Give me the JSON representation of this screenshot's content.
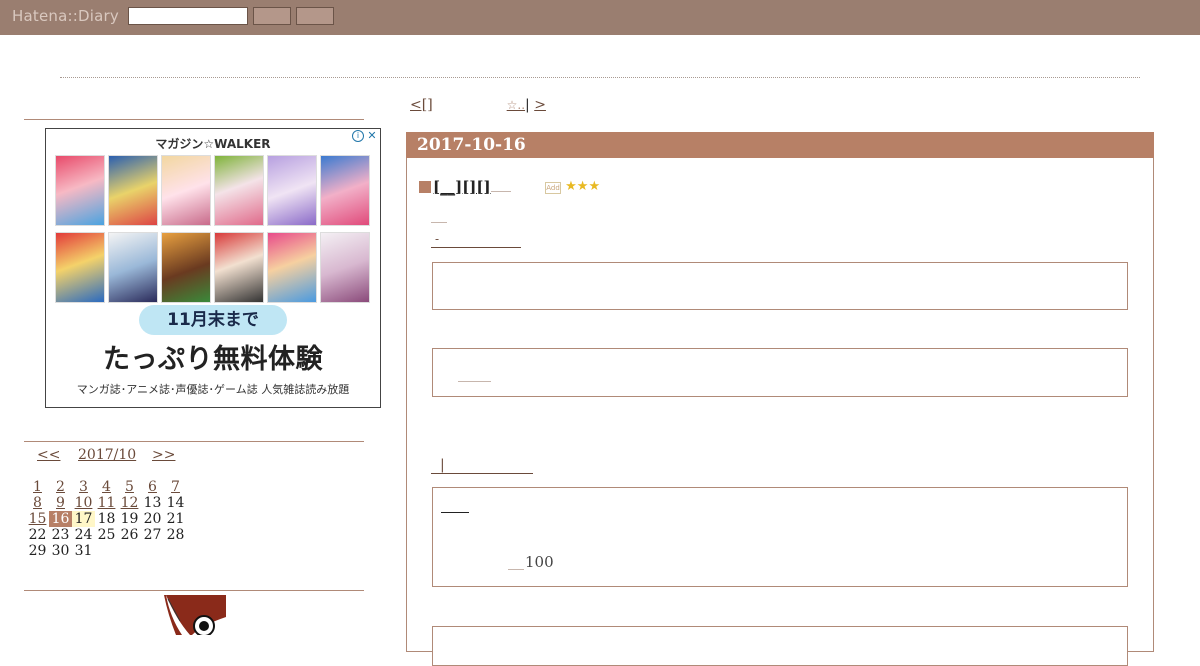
{
  "header": {
    "logo": "Hatena::Diary",
    "search_placeholder": ""
  },
  "sidebar": {
    "ad": {
      "title": "マガジン☆WALKER",
      "close_glyph": "✕",
      "info_glyph": "i",
      "deadline": "11月末まで",
      "headline": "たっぷり無料体験",
      "subline": "マンガ誌･アニメ誌･声優誌･ゲーム誌 人気雑誌読み放題"
    },
    "calendar": {
      "prev": "<<",
      "month": "2017/10",
      "next": ">>",
      "weeks": [
        [
          "1",
          "2",
          "3",
          "4",
          "5",
          "6",
          "7"
        ],
        [
          "8",
          "9",
          "10",
          "11",
          "12",
          "13",
          "14"
        ],
        [
          "15",
          "16",
          "17",
          "18",
          "19",
          "20",
          "21"
        ],
        [
          "22",
          "23",
          "24",
          "25",
          "26",
          "27",
          "28"
        ],
        [
          "29",
          "30",
          "31",
          "",
          "",
          "",
          ""
        ]
      ],
      "linked_days": [
        "1",
        "2",
        "3",
        "4",
        "5",
        "6",
        "7",
        "8",
        "9",
        "10",
        "11",
        "12",
        "15",
        "16"
      ],
      "current_day": "16",
      "today": "17"
    }
  },
  "main": {
    "pager": {
      "prev_label": "<[]",
      "prev_star": "☆..",
      "separator": "|",
      "next_label": ">"
    },
    "day": {
      "date": "2017-10-16",
      "entry_title": "[__][][]",
      "star_add": "Add",
      "stars": "★★★",
      "sub_link_1": "-",
      "sub_link_2": "|",
      "number": "100"
    }
  },
  "colors": {
    "topbar": "#9a7e70",
    "accent": "#b78066",
    "link": "#6a4a3a"
  }
}
